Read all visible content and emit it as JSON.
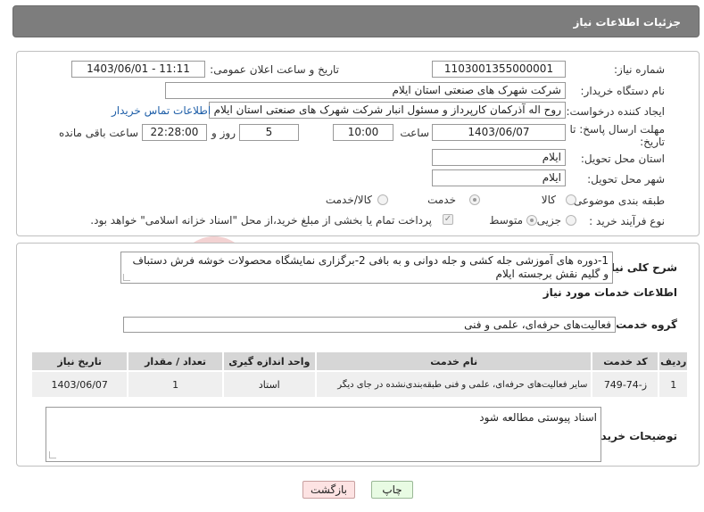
{
  "page": {
    "title": "جزئیات اطلاعات نیاز"
  },
  "form": {
    "need_number_label": "شماره نیاز:",
    "need_number": "1103001355000001",
    "announce_label": "تاریخ و ساعت اعلان عمومی:",
    "announce_value": "1403/06/01 - 11:11",
    "buyer_label": "نام دستگاه خریدار:",
    "buyer_value": "شرکت شهرک های صنعتی استان ایلام",
    "creator_label": "ایجاد کننده درخواست:",
    "creator_value": "روح اله آذرکمان کارپرداز و مسئول انبار شرکت شهرک های صنعتی استان ایلام",
    "contact_link": "اطلاعات تماس خریدار",
    "deadline_label_1": "مهلت ارسال پاسخ: تا",
    "deadline_label_2": "تاریخ:",
    "deadline_date": "1403/06/07",
    "hour_label": "ساعت",
    "deadline_hour": "10:00",
    "days_value": "5",
    "days_label": "روز و",
    "remaining_time": "22:28:00",
    "remaining_label": "ساعت باقی مانده",
    "province_label": "استان محل تحویل:",
    "province_value": "ایلام",
    "city_label": "شهر محل تحویل:",
    "city_value": "ایلام",
    "category_label": "طبقه بندی موضوعی:",
    "category_options": [
      "کالا",
      "خدمت",
      "کالا/خدمت"
    ],
    "category_selected": "خدمت",
    "process_label": "نوع فرآیند خرید :",
    "process_options": [
      "جزیی",
      "متوسط"
    ],
    "process_selected": "متوسط",
    "payment_note": "پرداخت تمام یا بخشی از مبلغ خرید،از محل \"اسناد خزانه اسلامی\" خواهد بود."
  },
  "details": {
    "summary_label": "شرح کلی نیاز:",
    "summary_value": "1-دوره های آموزشی جله کشی و جله دوانی و به بافی  2-برگزاری نمایشگاه محصولات خوشه فرش دستباف و گلیم نقش برجسته ایلام",
    "services_heading": "اطلاعات خدمات مورد نیاز",
    "service_group_label": "گروه خدمت:",
    "service_group_value": "فعالیت‌های حرفه‌ای، علمی و فنی",
    "table": {
      "headers": [
        "ردیف",
        "کد خدمت",
        "نام خدمت",
        "واحد اندازه گیری",
        "تعداد / مقدار",
        "تاریخ نیاز"
      ],
      "rows": [
        [
          "1",
          "ز-74-749",
          "سایر فعالیت‌های حرفه‌ای، علمی و فنی طبقه‌بندی‌نشده در جای دیگر",
          "استاد",
          "1",
          "1403/06/07"
        ]
      ]
    },
    "buyer_notes_label": "توضیحات خریدار:",
    "buyer_notes_value": "اسناد پیوستی مطالعه شود"
  },
  "actions": {
    "print_label": "چاپ",
    "back_label": "بازگشت"
  },
  "watermark": {
    "text": "AriaTender.neT"
  }
}
